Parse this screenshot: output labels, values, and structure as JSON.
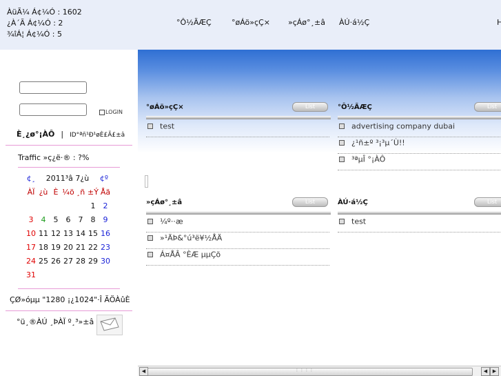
{
  "stats": {
    "line1": "ÀüÃ¼ Á¢¼Ó : 1602",
    "line2": "¿À´Ã Á¢¼Ó : 2",
    "line3": "¾îÁ¦ Á¢¼Ó : 5"
  },
  "topnav": [
    "°Ô½ÃÆÇ",
    "°øÁö»çÇ×",
    "»çÁø°¸±â",
    "ÀÚ·á½Ç"
  ],
  "topnav_cut": "H",
  "login": {
    "button_label": "LOGIN",
    "join_link": "È¸¿ø°¡ÀÔ",
    "separator": "|",
    "find_link": "ID°ªñ¹Ð¹øÈ£Ã£±â"
  },
  "traffic_text": "Traffic »ç¿ë·® : ?%",
  "calendar": {
    "prev": "¢¸",
    "title": "2011³â 7¿ù",
    "next": "¢º",
    "weekdays": [
      "ÀÏ",
      "¿ù",
      "È",
      "¼ö",
      "¸ñ",
      "±Ý",
      "Åä"
    ],
    "weeks": [
      [
        "",
        "",
        "",
        "",
        "",
        "1",
        "2"
      ],
      [
        "3",
        "4",
        "5",
        "6",
        "7",
        "8",
        "9"
      ],
      [
        "10",
        "11",
        "12",
        "13",
        "14",
        "15",
        "16"
      ],
      [
        "17",
        "18",
        "19",
        "20",
        "21",
        "22",
        "23"
      ],
      [
        "24",
        "25",
        "26",
        "27",
        "28",
        "29",
        "30"
      ],
      [
        "31",
        "",
        "",
        "",
        "",
        "",
        ""
      ]
    ],
    "colors": {
      "sunday": "#e00000",
      "saturday": "#1a22d8",
      "today": "#1a9a1a",
      "weekday": "#111111",
      "header": "#c00000"
    }
  },
  "resolution_text": "ÇØ»óµµ \"1280 ¡¿1024\"·Î ÃÖÀûÈ­",
  "mail_text": "°ü¸®ÀÚ ¸ÞÀÏ º¸³»±â",
  "boards": [
    {
      "title": "°øÁö»çÇ×",
      "list_label": "List",
      "items": [
        "test"
      ]
    },
    {
      "title": "°Ô½ÃÆÇ",
      "list_label": "List",
      "items": [
        "advertising company dubai",
        "¿¹ñ±º ³¡³µ´Ù!!",
        "³ªµÎ °¡ÀÔ"
      ]
    },
    {
      "title": "»çÁø°¸±â",
      "list_label": "List",
      "items": [
        "¼º··æ",
        "»¹ÄÞ&°ú³ë¥½ÅÄ",
        "Á¤ÅÂ °ÈÆ µµÇõ"
      ]
    },
    {
      "title": "ÀÚ·á½Ç",
      "list_label": "List",
      "items": [
        "test"
      ]
    }
  ],
  "colors": {
    "topbar": "#e9eef9",
    "header_blue": "#2f6fd3",
    "pink_divider": "#e79ad6"
  }
}
